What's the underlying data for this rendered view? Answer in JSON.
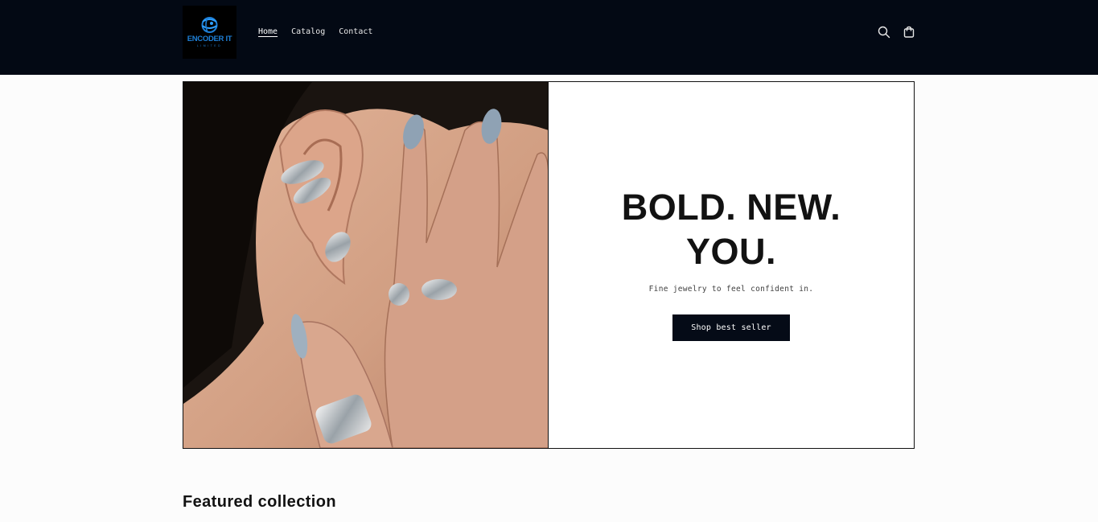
{
  "brand": {
    "logo_text": "ENCODER IT",
    "logo_subtext": "LIMITED",
    "accent_color": "#1e7fd6"
  },
  "header": {
    "background": "#030914",
    "nav": [
      {
        "label": "Home",
        "active": true
      },
      {
        "label": "Catalog",
        "active": false
      },
      {
        "label": "Contact",
        "active": false
      }
    ],
    "icons": [
      "search-icon",
      "cart-icon"
    ]
  },
  "hero": {
    "heading_line1": "BOLD. NEW.",
    "heading_line2": "YOU.",
    "subheading": "Fine jewelry to feel confident in.",
    "button_label": "Shop best seller",
    "image_description_icon": "jewelry-model-image"
  },
  "featured": {
    "title": "Featured collection"
  }
}
